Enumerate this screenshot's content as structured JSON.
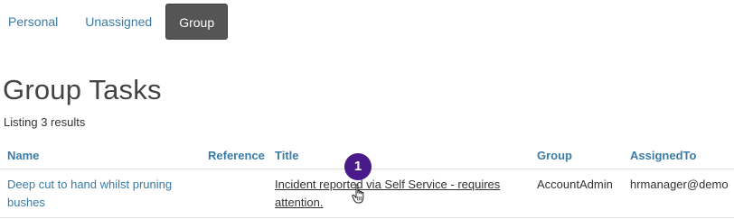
{
  "tabs": [
    {
      "label": "Personal",
      "active": false
    },
    {
      "label": "Unassigned",
      "active": false
    },
    {
      "label": "Group",
      "active": true
    }
  ],
  "page_title": "Group Tasks",
  "result_count": "Listing 3 results",
  "table": {
    "headers": [
      "Name",
      "Reference",
      "Title",
      "Group",
      "AssignedTo"
    ],
    "rows": [
      {
        "name": "Deep cut to hand whilst pruning bushes",
        "reference": "",
        "title": "Incident reported via Self Service - requires attention.",
        "group": "AccountAdmin",
        "assigned_to": "hrmanager@demo"
      }
    ]
  },
  "step_marker": "1",
  "colors": {
    "link": "#3a7ca5",
    "active_tab_bg": "#555555",
    "marker": "#4b1a8a"
  },
  "icons": {
    "cursor": "hand-pointer-icon"
  }
}
